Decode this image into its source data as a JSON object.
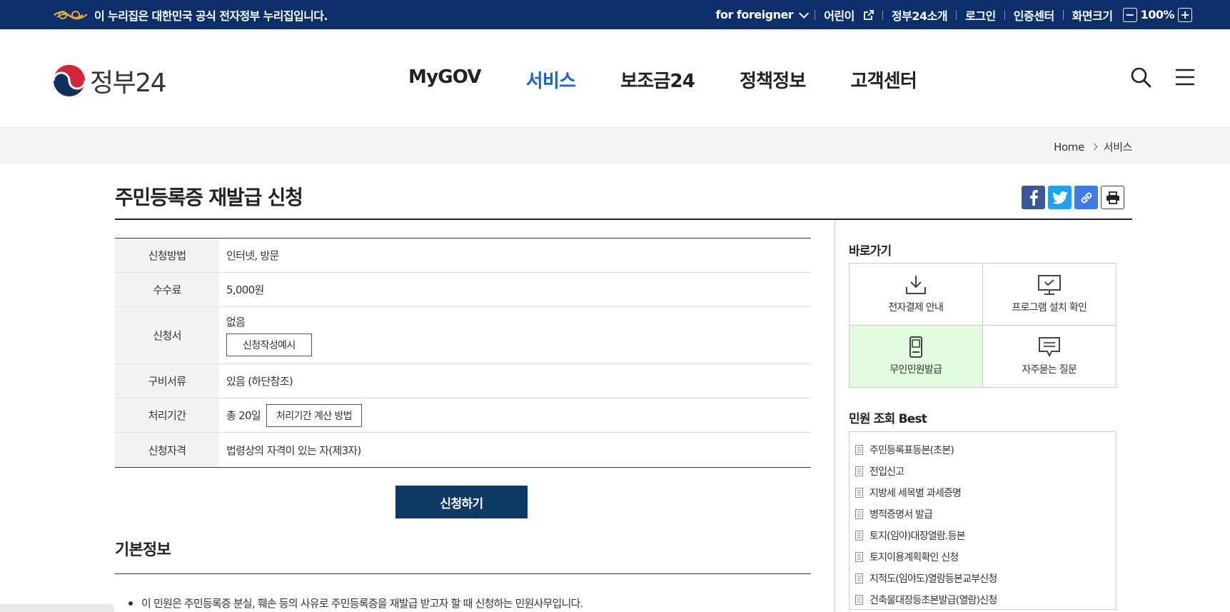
{
  "gov_bar": {
    "notice": "이 누리집은 대한민국 공식 전자정부 누리집입니다.",
    "foreigner": "for foreigner",
    "kids": "어린이",
    "about": "정부24소개",
    "login": "로그인",
    "cert": "인증센터",
    "screen_size": "화면크기",
    "zoom_minus": "−",
    "zoom_value": "100%",
    "zoom_plus": "+"
  },
  "header": {
    "logo_text": "정부24",
    "nav": [
      "MyGOV",
      "서비스",
      "보조금24",
      "정책정보",
      "고객센터"
    ],
    "active_nav_index": 1
  },
  "breadcrumb": {
    "home": "Home",
    "current": "서비스"
  },
  "page": {
    "title": "주민등록증 재발급 신청"
  },
  "info": {
    "rows": [
      {
        "label": "신청방법",
        "value": "인터넷, 방문"
      },
      {
        "label": "수수료",
        "value": "5,000원"
      },
      {
        "label": "신청서",
        "value": "없음",
        "button": "신청작성예시"
      },
      {
        "label": "구비서류",
        "value": "있음 (하단참조)"
      },
      {
        "label": "처리기간",
        "value": "총 20일",
        "button": "처리기간 계산 방법"
      },
      {
        "label": "신청자격",
        "value": "법령상의 자격이 있는 자(제3자)"
      }
    ]
  },
  "apply_label": "신청하기",
  "basic_info": {
    "title": "기본정보",
    "bullet": "이 민원은 주민등록증 분실, 훼손 등의 사유로 주민등록증을 재발급 받고자 할 때 신청하는 민원사무입니다."
  },
  "sidebar": {
    "quick_title": "바로가기",
    "quick_links": [
      "전자결제 안내",
      "프로그램 설치 확인",
      "무인민원발급",
      "자주묻는 질문"
    ],
    "best_title": "민원 조회 Best",
    "best_items": [
      "주민등록표등본(초본)",
      "전입신고",
      "지방세 세목별 과세증명",
      "병적증명서 발급",
      "토지(임야)대장열람.등본",
      "토지이용계획확인 신청",
      "지적도(임야도)열람등본교부신청",
      "건축물대장등초본발급(열람)신청"
    ]
  },
  "colors": {
    "gov_bar": "#0c2f6c",
    "active_nav": "#1a63d6",
    "apply_button": "#0f3a63",
    "highlight_cell": "#e3fbdf"
  }
}
